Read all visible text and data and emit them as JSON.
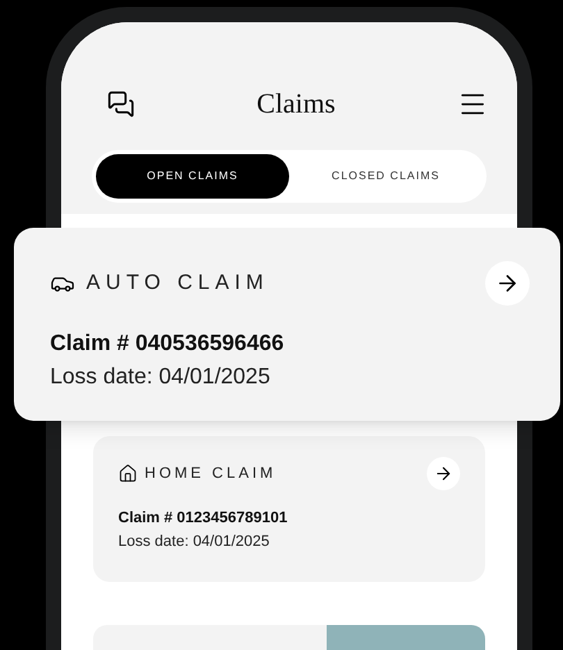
{
  "header": {
    "title": "Claims"
  },
  "tabs": [
    {
      "label": "OPEN CLAIMS",
      "selected": true
    },
    {
      "label": "CLOSED CLAIMS",
      "selected": false
    }
  ],
  "featured_claim": {
    "kind": "auto",
    "type_label": "AUTO CLAIM",
    "claim_number": "Claim # 040536596466",
    "loss_date": "Loss date: 04/01/2025"
  },
  "claims": [
    {
      "kind": "home",
      "type_label": "HOME CLAIM",
      "claim_number": "Claim # 0123456789101",
      "loss_date": "Loss date: 04/01/2025"
    }
  ]
}
